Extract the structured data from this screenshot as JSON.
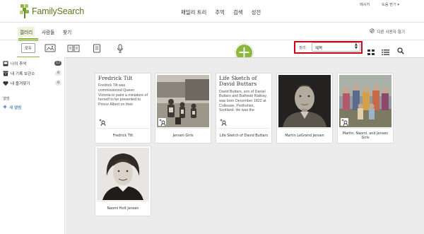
{
  "brand": {
    "name": "FamilySearch",
    "accent": "#8cb83e"
  },
  "topnav": [
    "패밀리 트리",
    "추억",
    "검색",
    "성전"
  ],
  "utility": {
    "messages": "메시지",
    "help": "도움 받기 ▾"
  },
  "subnav": {
    "tabs": [
      "갤러리",
      "사람들",
      "찾기"
    ],
    "active": "갤러리",
    "try_new": "다른 사용자 함기"
  },
  "toolbar": {
    "filter_all": "모두",
    "filter_icons": [
      "photo-filter-icon",
      "book-filter-icon",
      "document-filter-icon",
      "audio-filter-icon"
    ],
    "add_icon": "+",
    "sort_label": "정리:",
    "sort_value": "제목"
  },
  "sidebar": {
    "items": [
      {
        "label": "나의 추억",
        "count": "17",
        "icon": "gallery-icon"
      },
      {
        "label": "내 기록 보관소",
        "count": "0",
        "icon": "archive-icon"
      },
      {
        "label": "내 즐겨찾기",
        "count": "0",
        "icon": "heart-icon"
      }
    ],
    "section_label": "앨범",
    "new_album": "새 앨범"
  },
  "cards": [
    {
      "type": "story",
      "title": "Fredrick Tilt",
      "body": "Fredrick Tilt was commissioned Queen Victoria to paint a miniature of herself to be presented to Prince Albert on their",
      "caption": "Fredrick Tilt"
    },
    {
      "type": "photo",
      "caption": "Jensen Girls"
    },
    {
      "type": "story",
      "title": "Life Sketch of David Buttars",
      "body": "David Buttars, son of Daniel Buttars and Batheah Rattray, was born December 1822 at Collessie, Perthshire, Scotland. He was the",
      "caption": "Life Sketch of David Buttars"
    },
    {
      "type": "photo",
      "caption": "Martin LeGrand Jensen"
    },
    {
      "type": "photo",
      "caption": "Martin, Naomi, and Jensen Girls"
    },
    {
      "type": "photo",
      "caption": "Naomi Holt Jensen"
    }
  ]
}
